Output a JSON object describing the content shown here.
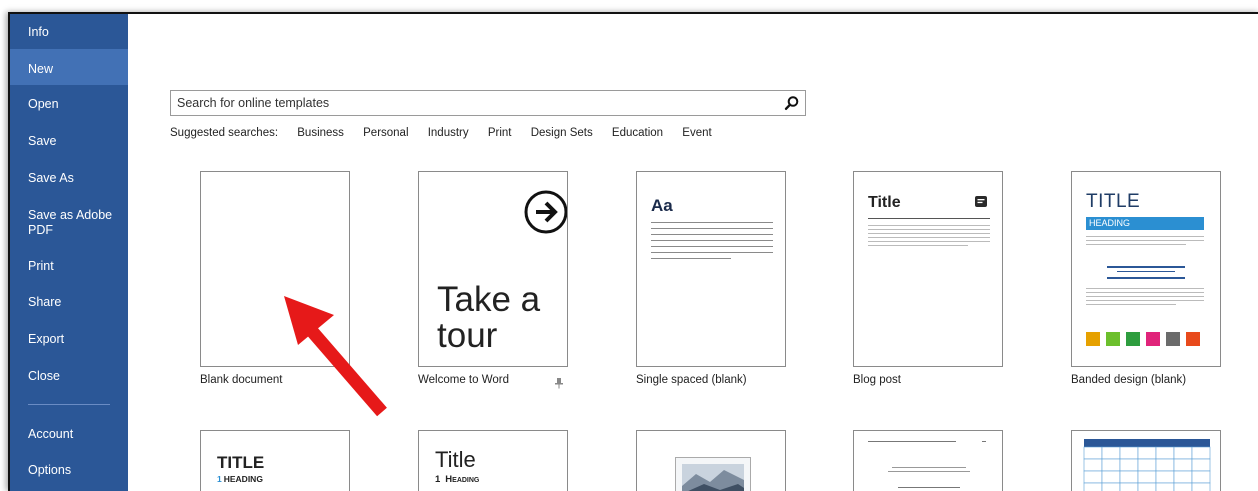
{
  "sidebar": {
    "items": [
      {
        "label": "Info"
      },
      {
        "label": "New"
      },
      {
        "label": "Open"
      },
      {
        "label": "Save"
      },
      {
        "label": "Save As"
      },
      {
        "label": "Save as Adobe PDF"
      },
      {
        "label": "Print"
      },
      {
        "label": "Share"
      },
      {
        "label": "Export"
      },
      {
        "label": "Close"
      },
      {
        "label": "Account"
      },
      {
        "label": "Options"
      }
    ],
    "selected": "New"
  },
  "search": {
    "placeholder": "Search for online templates",
    "icon": "search-icon"
  },
  "suggested": {
    "label": "Suggested searches:",
    "items": [
      "Business",
      "Personal",
      "Industry",
      "Print",
      "Design Sets",
      "Education",
      "Event"
    ]
  },
  "templates": {
    "blank": {
      "caption": "Blank document"
    },
    "tour": {
      "caption": "Welcome to Word",
      "line1": "Take a",
      "line2": "tour",
      "icon": "arrow-right-circle-icon",
      "pin_icon": "pin-icon"
    },
    "single": {
      "caption": "Single spaced (blank)",
      "heading": "Aa"
    },
    "blog": {
      "caption": "Blog post",
      "title": "Title",
      "icon": "note-icon"
    },
    "banded": {
      "caption": "Banded design (blank)",
      "title": "TITLE",
      "heading": "HEADING",
      "swatches": [
        "#e6a100",
        "#6cbf2c",
        "#2e9d3e",
        "#e0247a",
        "#6b6b6b",
        "#e84a1c"
      ]
    },
    "row2_a": {
      "title": "TITLE",
      "heading_num": "1",
      "heading": "HEADING"
    },
    "row2_b": {
      "title": "Title",
      "heading_num": "1",
      "heading": "Heading"
    }
  },
  "colors": {
    "sidebar": "#2b5797",
    "selected": "#4271b5",
    "banded_accent": "#2b8fd2",
    "arrow": "#e61919"
  }
}
